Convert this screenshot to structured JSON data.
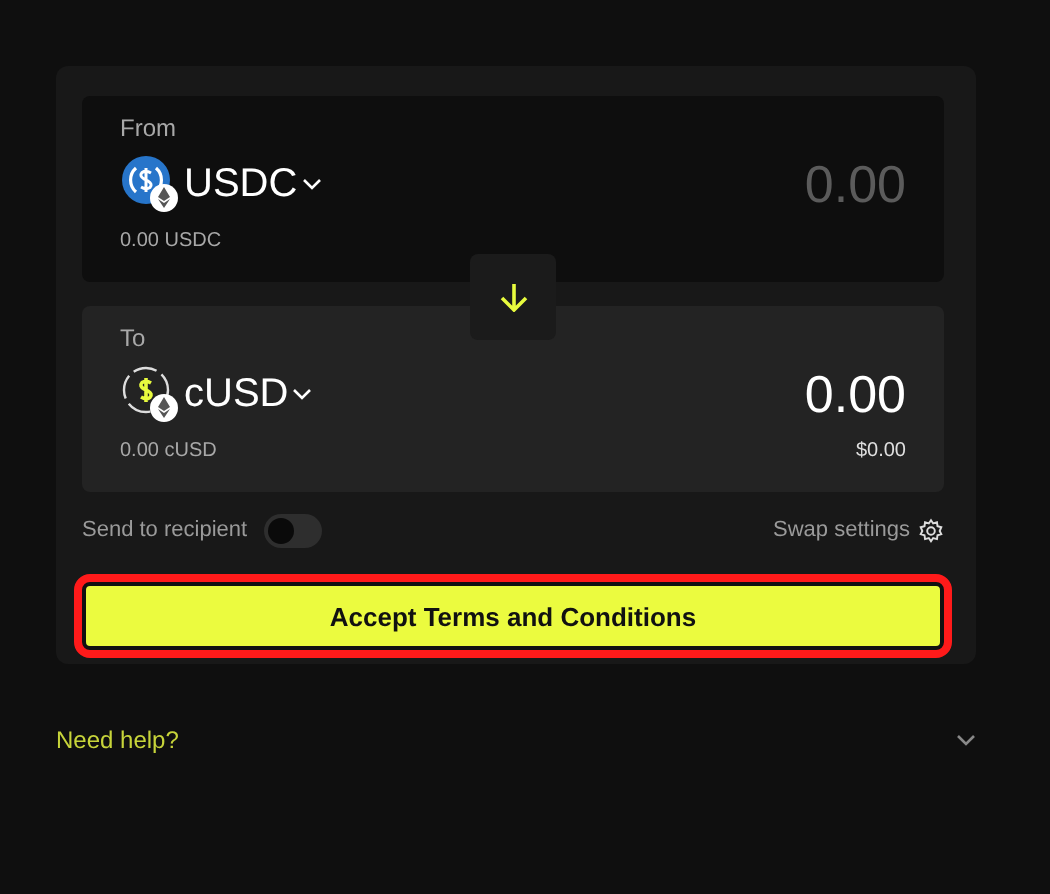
{
  "from": {
    "label": "From",
    "token": "USDC",
    "amount": "0.00",
    "balance": "0.00 USDC"
  },
  "to": {
    "label": "To",
    "token": "cUSD",
    "amount": "0.00",
    "balance": "0.00 cUSD",
    "usd_value": "$0.00"
  },
  "recipient": {
    "label": "Send to recipient",
    "on": false
  },
  "settings": {
    "label": "Swap settings"
  },
  "action": {
    "label": "Accept Terms and Conditions",
    "highlighted": true
  },
  "help": {
    "label": "Need help?",
    "expanded": false
  }
}
